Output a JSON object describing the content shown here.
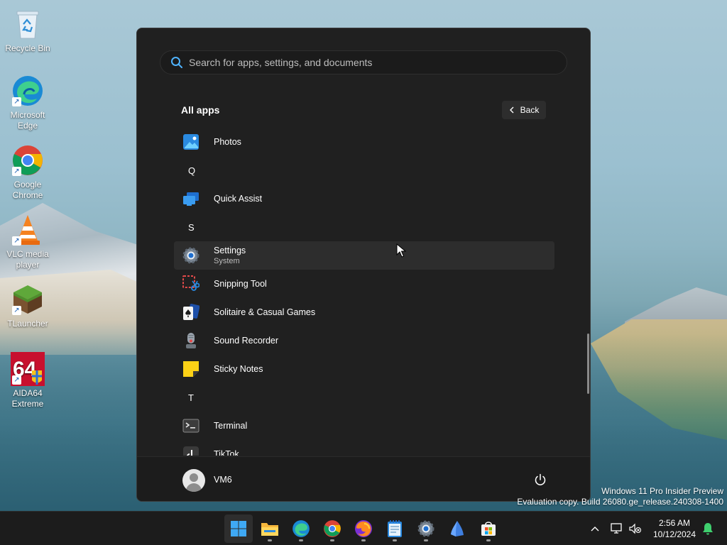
{
  "desktop": {
    "icons": [
      {
        "label": "Recycle Bin",
        "icon": "recycle-bin-icon"
      },
      {
        "label": "Microsoft Edge",
        "icon": "edge-icon"
      },
      {
        "label": "Google Chrome",
        "icon": "chrome-icon"
      },
      {
        "label": "VLC media player",
        "icon": "vlc-icon"
      },
      {
        "label": "TLauncher",
        "icon": "tlauncher-icon"
      },
      {
        "label": "AIDA64 Extreme",
        "icon": "aida64-icon"
      }
    ],
    "watermark": {
      "line1": "Windows 11 Pro Insider Preview",
      "line2": "Evaluation copy. Build 26080.ge_release.240308-1400"
    }
  },
  "start_menu": {
    "search_placeholder": "Search for apps, settings, and documents",
    "section_title": "All apps",
    "back_label": "Back",
    "items": [
      {
        "type": "app",
        "name": "Photos",
        "icon": "photos-icon"
      },
      {
        "type": "letter",
        "name": "Q"
      },
      {
        "type": "app",
        "name": "Quick Assist",
        "icon": "quick-assist-icon"
      },
      {
        "type": "letter",
        "name": "S"
      },
      {
        "type": "app",
        "name": "Settings",
        "sub": "System",
        "icon": "settings-icon",
        "hover": true
      },
      {
        "type": "app",
        "name": "Snipping Tool",
        "icon": "snipping-tool-icon"
      },
      {
        "type": "app",
        "name": "Solitaire & Casual Games",
        "icon": "solitaire-icon"
      },
      {
        "type": "app",
        "name": "Sound Recorder",
        "icon": "sound-recorder-icon"
      },
      {
        "type": "app",
        "name": "Sticky Notes",
        "icon": "sticky-notes-icon"
      },
      {
        "type": "letter",
        "name": "T"
      },
      {
        "type": "app",
        "name": "Terminal",
        "icon": "terminal-icon"
      },
      {
        "type": "app",
        "name": "TikTok",
        "icon": "tiktok-icon"
      }
    ],
    "user_name": "VM6"
  },
  "taskbar": {
    "apps": [
      "start-icon",
      "file-explorer-icon",
      "edge-icon",
      "chrome-icon",
      "firefox-icon",
      "notepad-icon",
      "settings-icon",
      "app-icon",
      "store-icon"
    ],
    "time": "2:56 AM",
    "date": "10/12/2024"
  },
  "colors": {
    "accent": "#0078d4",
    "menu_bg": "#202020",
    "hover_bg": "#2d2d2d"
  }
}
